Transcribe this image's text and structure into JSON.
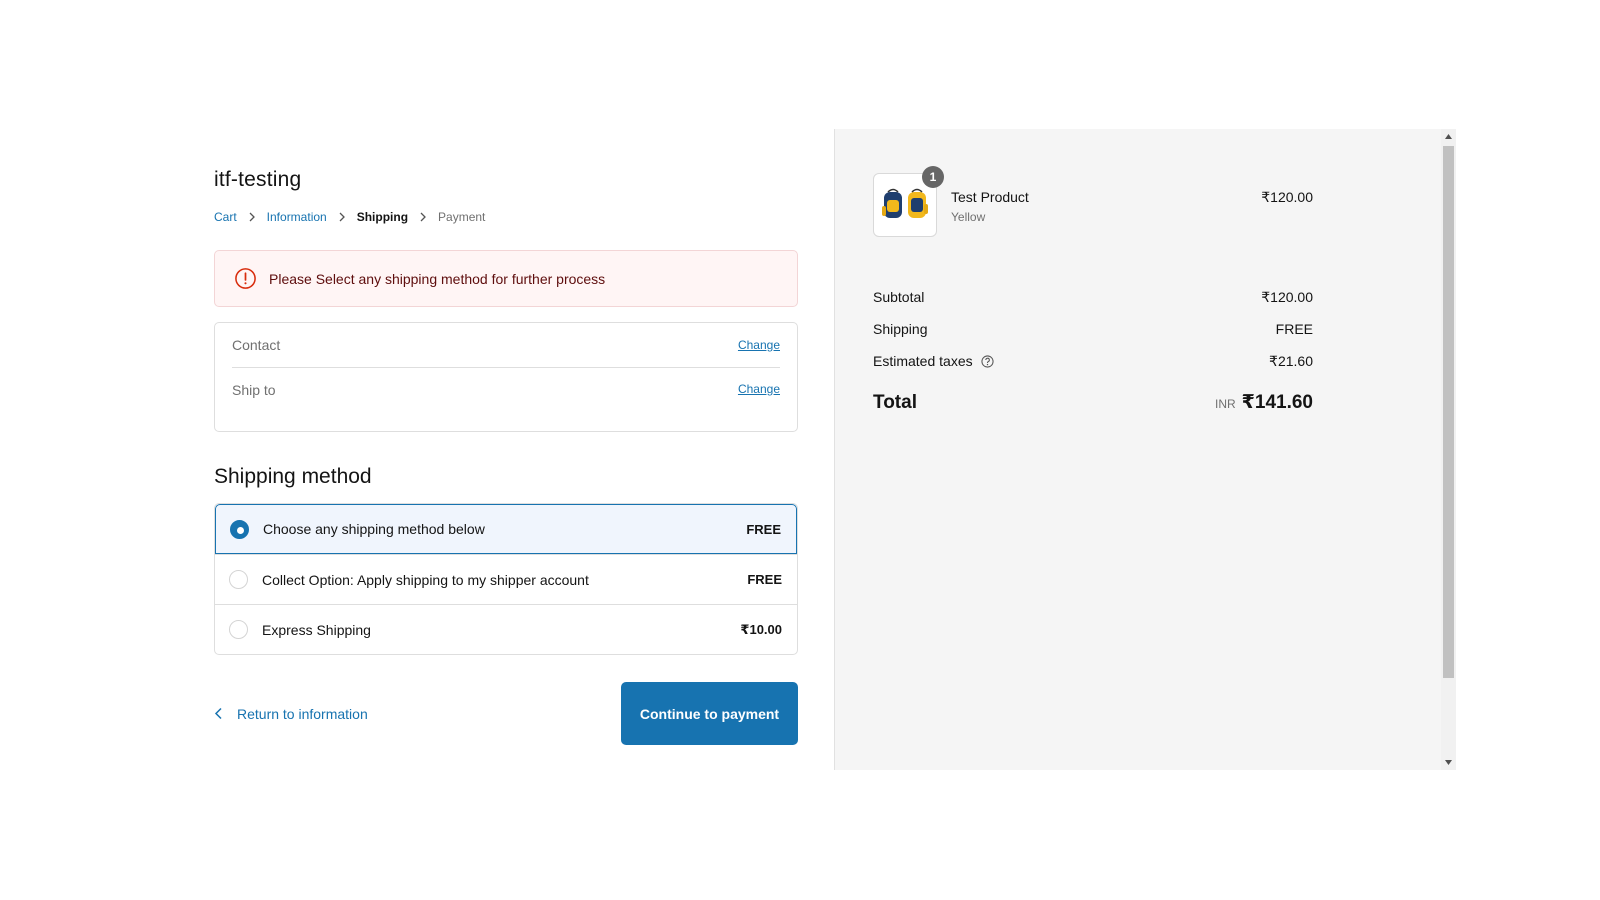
{
  "store": {
    "title": "itf-testing"
  },
  "breadcrumb": {
    "cart": "Cart",
    "information": "Information",
    "shipping": "Shipping",
    "payment": "Payment"
  },
  "alert": {
    "message": "Please Select any shipping method for further process",
    "icon": "alert-circle-icon",
    "color": "#d82c0d"
  },
  "review": {
    "contact_label": "Contact",
    "ship_to_label": "Ship to",
    "change_label": "Change"
  },
  "shipping": {
    "title": "Shipping method",
    "methods": [
      {
        "label": "Choose any shipping method below",
        "price": "FREE",
        "selected": true
      },
      {
        "label": "Collect Option: Apply shipping to my shipper account",
        "price": "FREE",
        "selected": false
      },
      {
        "label": "Express Shipping",
        "price": "₹10.00",
        "selected": false
      }
    ]
  },
  "actions": {
    "return_label": "Return to information",
    "continue_label": "Continue to payment",
    "accent": "#1773b0"
  },
  "order": {
    "product": {
      "name": "Test Product",
      "variant": "Yellow",
      "price": "₹120.00",
      "quantity": "1"
    },
    "subtotal_label": "Subtotal",
    "subtotal": "₹120.00",
    "shipping_label": "Shipping",
    "shipping": "FREE",
    "taxes_label": "Estimated taxes",
    "taxes": "₹21.60",
    "total_label": "Total",
    "currency": "INR",
    "total": "₹141.60"
  }
}
